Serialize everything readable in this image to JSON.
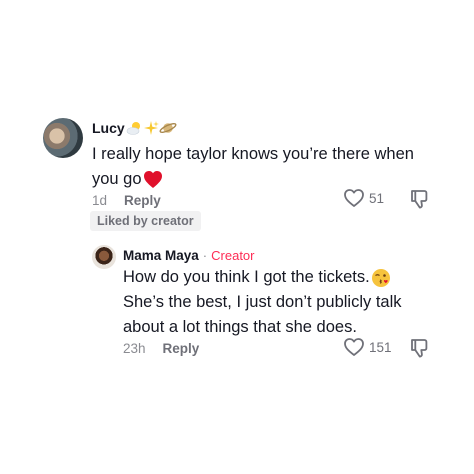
{
  "comment": {
    "author": "Lucy",
    "author_emojis": [
      "cloud-sun-icon",
      "sparkles-icon",
      "planet-icon"
    ],
    "text_line1": "I really hope taylor knows you’re there when",
    "text_line2": "you go",
    "text_emoji": "red-heart-icon",
    "time": "1d",
    "reply_label": "Reply",
    "like_count": "51",
    "liked_by_creator": "Liked by creator"
  },
  "reply": {
    "author": "Mama Maya",
    "separator": "·",
    "badge": "Creator",
    "text_line1": "How do you think I got the tickets.",
    "text_emoji": "winking-kiss-icon",
    "text_line2": "She’s the best, I just don’t publicly talk",
    "text_line3": "about a lot things that she does.",
    "time": "23h",
    "reply_label": "Reply",
    "like_count": "151"
  },
  "colors": {
    "creator_accent": "#fe2c55",
    "muted_text": "#8a8b91",
    "heart_red": "#e0102b"
  }
}
